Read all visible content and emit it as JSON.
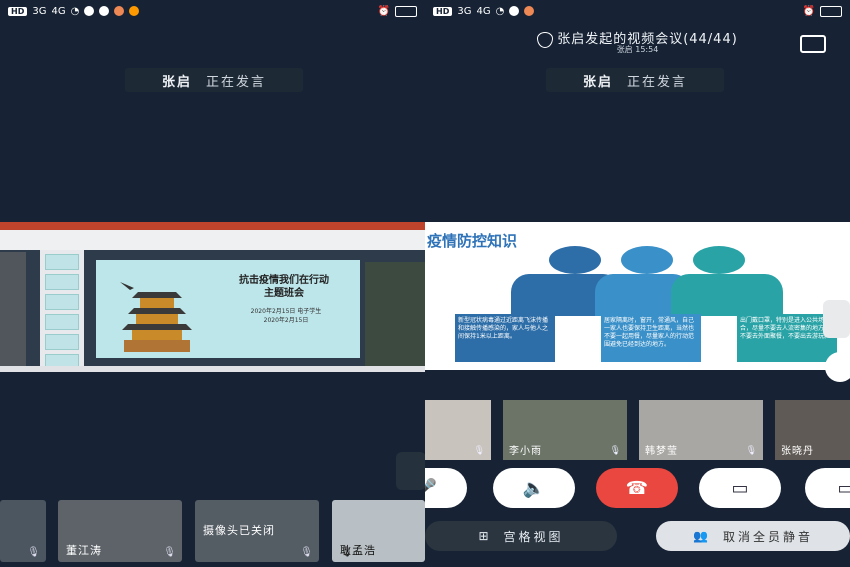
{
  "left_screen": {
    "status_bar": {
      "left_icons": [
        "HD",
        "3G",
        "4G"
      ],
      "right_icons": [
        "alarm-icon",
        "battery-icon"
      ]
    },
    "speaker_banner": {
      "name": "张启",
      "status": "正在发言"
    },
    "shared_slide": {
      "title": "抗击疫情我们在行动\n主题班会",
      "subtitle": "2020年2月15日 电子学生\n2020年2月15日"
    },
    "participants": [
      {
        "name": ""
      },
      {
        "name": "董江涛"
      },
      {
        "name": "摄像头已关闭"
      },
      {
        "name": "耿孟浩"
      }
    ]
  },
  "right_screen": {
    "meeting": {
      "title": "张启发起的视频会议(44/44)",
      "time_prefix": "张启",
      "time": "15:54"
    },
    "speaker_banner": {
      "name": "张启",
      "status": "正在发言"
    },
    "slide": {
      "title": "疫情防控知识",
      "text_boxes": [
        "新型冠状病毒通过近距离飞沫传播和接触传播感染的，家人与他人之间保持1米以上距离。",
        "居家隔离时，窗开，常通风，自己一家人也要保持卫生距离，当然也不要一起用餐，尽量家人的行动范围避免已经到达的地方。",
        "出门戴口罩，特别是进入公共场合，尽量不要去人流密集的地方，不要去外面聚餐，不要出去游玩。"
      ]
    },
    "participants": [
      {
        "name": ""
      },
      {
        "name": "李小雨"
      },
      {
        "name": "韩梦莹"
      },
      {
        "name": "张晓丹"
      }
    ],
    "controls": {
      "mute": "mic-off-icon",
      "speaker": "speaker-icon",
      "hangup": "hangup-icon",
      "video": "video-icon",
      "share": "share-icon"
    },
    "bottom": {
      "grid_label": "宫格视图",
      "unmute_all_label": "取消全员静音"
    },
    "colors": {
      "hangup": "#e9473f",
      "slide_blue": "#2f73b8",
      "teal": "#2aa3a6"
    }
  }
}
